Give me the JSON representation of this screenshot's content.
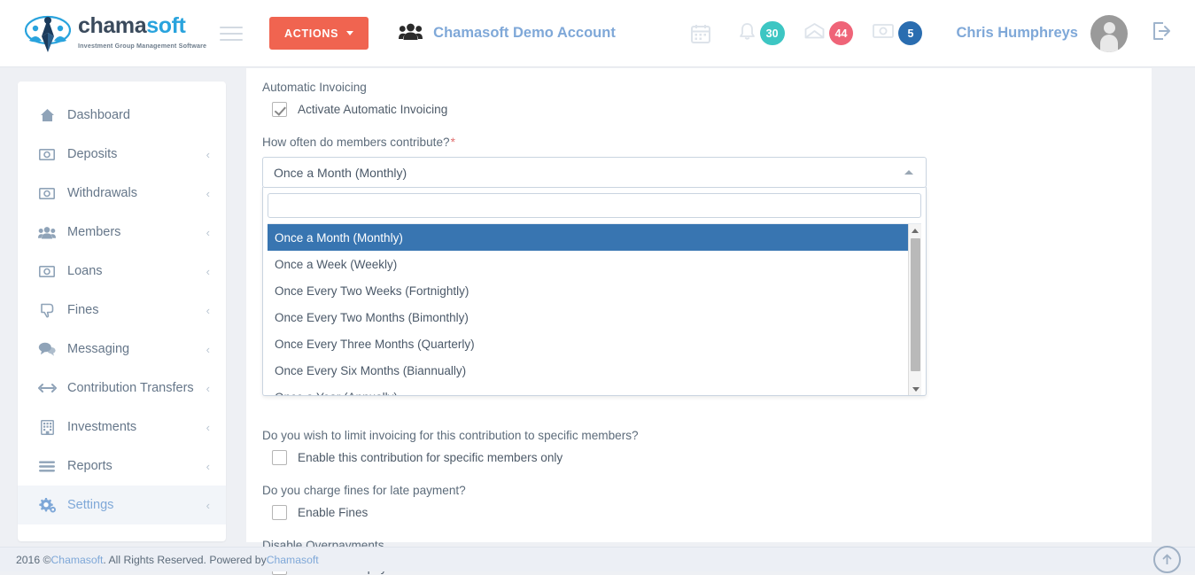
{
  "header": {
    "logo": {
      "word_1": "chama",
      "word_2": "soft",
      "tagline": "Investment Group Management Software"
    },
    "menu_toggle_name": "hamburger-icon",
    "actions_label": "ACTIONS",
    "account_name": "Chamasoft Demo Account",
    "icons": {
      "calendar": "calendar-icon",
      "bell": "bell-icon",
      "mail": "envelope-icon",
      "cash": "money-icon",
      "logout": "logout-icon"
    },
    "badges": {
      "notifications": "30",
      "messages": "44",
      "payments": "5"
    },
    "badge_colors": {
      "notifications": "#3dc6c3",
      "messages": "#ef6478",
      "payments": "#2a6db0"
    },
    "user_name": "Chris Humphreys"
  },
  "sidebar": {
    "items": [
      {
        "label": "Dashboard",
        "icon": "home-icon",
        "chevron": false,
        "active": false
      },
      {
        "label": "Deposits",
        "icon": "money-icon",
        "chevron": true,
        "active": false
      },
      {
        "label": "Withdrawals",
        "icon": "money-icon",
        "chevron": true,
        "active": false
      },
      {
        "label": "Members",
        "icon": "users-icon",
        "chevron": true,
        "active": false
      },
      {
        "label": "Loans",
        "icon": "money-icon",
        "chevron": true,
        "active": false
      },
      {
        "label": "Fines",
        "icon": "thumbs-down-icon",
        "chevron": true,
        "active": false
      },
      {
        "label": "Messaging",
        "icon": "chat-icon",
        "chevron": true,
        "active": false
      },
      {
        "label": "Contribution Transfers",
        "icon": "arrows-icon",
        "chevron": true,
        "active": false
      },
      {
        "label": "Investments",
        "icon": "building-icon",
        "chevron": true,
        "active": false
      },
      {
        "label": "Reports",
        "icon": "bars-icon",
        "chevron": true,
        "active": false
      },
      {
        "label": "Settings",
        "icon": "gears-icon",
        "chevron": true,
        "active": true
      }
    ],
    "chevron_glyph": "‹"
  },
  "form": {
    "automatic_invoicing_label": "Automatic Invoicing",
    "activate_checkbox_label": "Activate Automatic Invoicing",
    "activate_checked": true,
    "frequency_label": "How often do members contribute?",
    "frequency_required_marker": "*",
    "frequency_value": "Once a Month (Monthly)",
    "frequency_search_value": "",
    "frequency_search_placeholder": "",
    "frequency_options": [
      "Once a Month (Monthly)",
      "Once a Week (Weekly)",
      "Once Every Two Weeks (Fortnightly)",
      "Once Every Two Months (Bimonthly)",
      "Once Every Three Months (Quarterly)",
      "Once Every Six Months (Biannually)",
      "Once a Year (Annually)"
    ],
    "frequency_selected_index": 0,
    "limit_invoicing_label": "Do you wish to limit invoicing for this contribution to specific members?",
    "limit_invoicing_checkbox_label": "Enable this contribution for specific members only",
    "limit_invoicing_checked": false,
    "fines_label": "Do you charge fines for late payment?",
    "fines_checkbox_label": "Enable Fines",
    "fines_checked": false,
    "overpayments_label": "Disable Overpayments",
    "overpayments_checkbox_label": "Disable Overpayments",
    "overpayments_checked": false
  },
  "footer": {
    "text_before": "2016 © ",
    "link_1": "Chamasoft",
    "text_middle": ". All Rights Reserved. Powered by ",
    "link_2": "Chamasoft",
    "text_after": "",
    "to_top_name": "scroll-to-top-button"
  },
  "colors": {
    "accent_orange": "#f06450",
    "link_blue": "#7fa8d8",
    "select_highlight": "#3875b1"
  }
}
